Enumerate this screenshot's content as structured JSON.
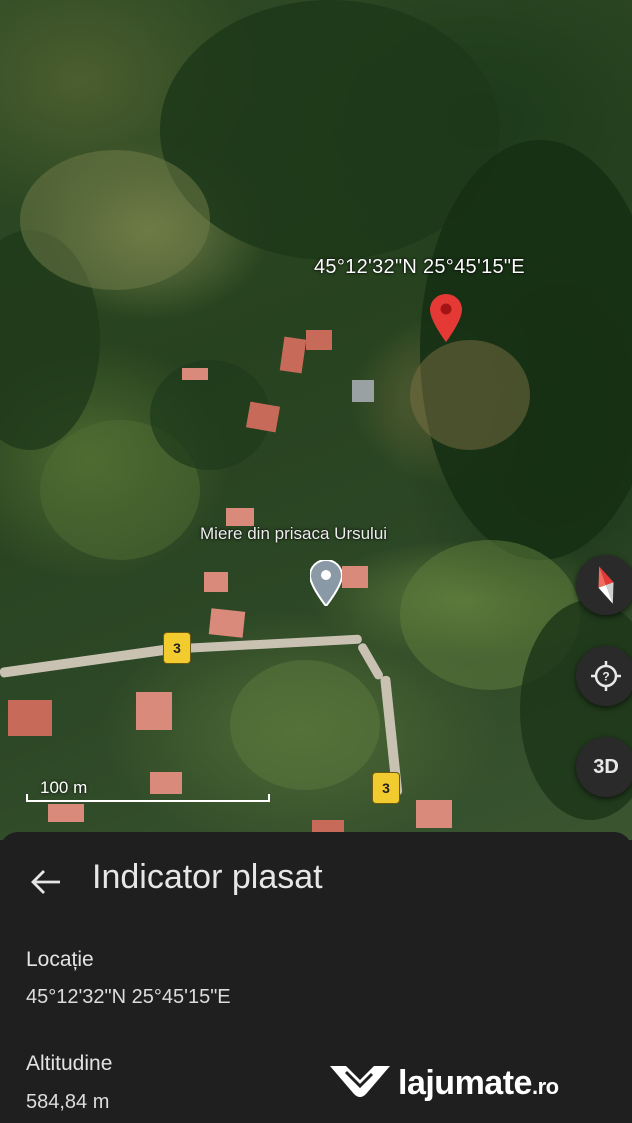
{
  "map": {
    "pin_coordinates": "45°12'32\"N 25°45'15\"E",
    "place_label": "Miere din prisaca Ursului",
    "route_shield_1": "3",
    "route_shield_2": "3",
    "scale_label": "100 m",
    "btn_3d_label": "3D",
    "pin_color": "#e53935",
    "place_pin_color": "#8a99a6"
  },
  "sheet": {
    "title": "Indicator plasat",
    "location_label": "Locație",
    "location_value": "45°12'32\"N 25°45'15\"E",
    "altitude_label": "Altitudine",
    "altitude_value": "584,84 m"
  },
  "watermark": {
    "brand": "lajumate",
    "suffix": ".ro"
  }
}
